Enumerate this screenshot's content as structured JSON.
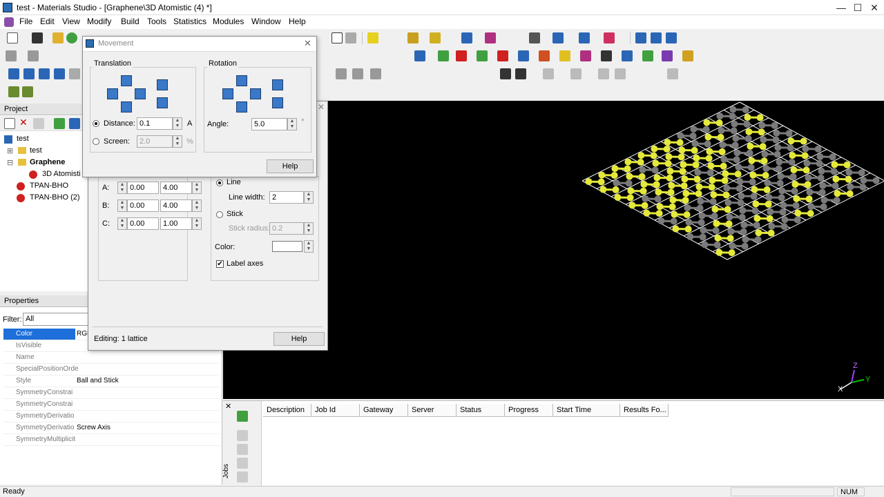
{
  "window": {
    "title": "test - Materials Studio - [Graphene\\3D Atomistic (4) *]",
    "close_glyph": "✕",
    "minimize_glyph": "—",
    "maximize_glyph": "☐"
  },
  "menubar": [
    "File",
    "Edit",
    "View",
    "Modify",
    "Build",
    "Tools",
    "Statistics",
    "Modules",
    "Window",
    "Help"
  ],
  "project_panel": {
    "title": "Project",
    "tree": [
      {
        "label": "test",
        "level": 0,
        "bold": false
      },
      {
        "label": "test",
        "level": 1,
        "bold": false
      },
      {
        "label": "Graphene",
        "level": 1,
        "bold": true
      },
      {
        "label": "3D Atomisti",
        "level": 2,
        "bold": false
      },
      {
        "label": "TPAN-BHO",
        "level": 1,
        "bold": false
      },
      {
        "label": "TPAN-BHO (2)",
        "level": 1,
        "bold": false
      }
    ]
  },
  "properties_panel": {
    "title": "Properties",
    "filter_label": "Filter:",
    "filter_value": "All",
    "rows": [
      {
        "name": "Color",
        "value": "RGB",
        "selected": true
      },
      {
        "name": "IsVisible",
        "value": "",
        "selected": false
      },
      {
        "name": "Name",
        "value": "",
        "selected": false
      },
      {
        "name": "SpecialPositionOrde",
        "value": "",
        "selected": false
      },
      {
        "name": "Style",
        "value": "Ball and Stick",
        "selected": false
      },
      {
        "name": "SymmetryConstrai",
        "value": "",
        "selected": false
      },
      {
        "name": "SymmetryConstrai",
        "value": "",
        "selected": false
      },
      {
        "name": "SymmetryDerivatio",
        "value": "",
        "selected": false
      },
      {
        "name": "SymmetryDerivatio",
        "value": "Screw Axis",
        "selected": false
      },
      {
        "name": "SymmetryMultiplicit",
        "value": "",
        "selected": false
      }
    ]
  },
  "movement_dialog": {
    "title": "Movement",
    "translation_label": "Translation",
    "rotation_label": "Rotation",
    "distance_label": "Distance:",
    "distance_value": "0.1",
    "distance_unit": "A",
    "screen_label": "Screen:",
    "screen_value": "2.0",
    "screen_unit": "%",
    "angle_label": "Angle:",
    "angle_value": "5.0",
    "angle_unit": "°",
    "help_label": "Help"
  },
  "lattice_dialog": {
    "rows": [
      {
        "label": "A:",
        "v1": "0.00",
        "v2": "4.00"
      },
      {
        "label": "B:",
        "v1": "0.00",
        "v2": "4.00"
      },
      {
        "label": "C:",
        "v1": "0.00",
        "v2": "1.00"
      }
    ],
    "line_label": "Line",
    "line_width_label": "Line width:",
    "line_width_value": "2",
    "stick_label": "Stick",
    "stick_radius_label": "Stick radius:",
    "stick_radius_value": "0.2",
    "color_label": "Color:",
    "label_axes_label": "Label axes",
    "editing_label": "Editing: 1 lattice",
    "help_label": "Help"
  },
  "jobs_panel": {
    "side_label": "Jobs",
    "columns": [
      "Description",
      "Job Id",
      "Gateway",
      "Server",
      "Status",
      "Progress",
      "Start Time",
      "Results Fo..."
    ]
  },
  "statusbar": {
    "status": "Ready",
    "num": "NUM"
  },
  "view3d": {
    "axis_x": "X",
    "axis_y": "Y",
    "axis_z": "Z",
    "carbon_color": "#7a7a7a",
    "selected_color": "#e4e83a",
    "lattice_color": "#ffffff"
  },
  "colors": {
    "selection": "#1e6fd9",
    "toolbar_blue": "#3a78c8"
  }
}
